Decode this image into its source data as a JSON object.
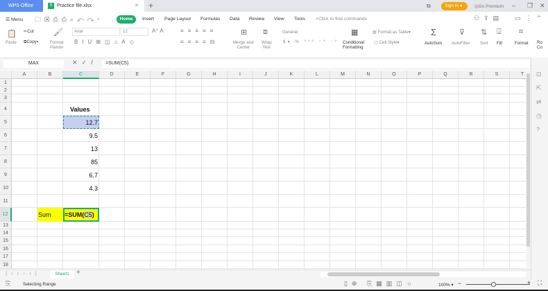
{
  "titlebar": {
    "app_tab": "WPS Office",
    "file_tab": "Practice file.xlsx",
    "sign_in": "Sign in",
    "go_premium": "Go Premium"
  },
  "menu": {
    "menu": "Menu",
    "tabs": [
      "Home",
      "Insert",
      "Page Layout",
      "Formulas",
      "Data",
      "Review",
      "View",
      "Tools"
    ],
    "search": "Click to find commands"
  },
  "ribbon": {
    "paste": "Paste",
    "cut": "Cut",
    "copy": "Copy",
    "format_painter_1": "Format",
    "format_painter_2": "Painter",
    "font": "Arial",
    "size": "12",
    "merge_1": "Merge and",
    "merge_2": "Center",
    "wrap_1": "Wrap",
    "wrap_2": "Text",
    "number_format": "General",
    "cond_1": "Conditional",
    "cond_2": "Formatting",
    "format_table": "Format as Table",
    "cell_style": "Cell Style",
    "autosum": "AutoSum",
    "autofilter": "AutoFilter",
    "sort": "Sort",
    "fill": "Fill",
    "format": "Format",
    "rows_cols_1": "Ro",
    "rows_cols_2": "Co"
  },
  "formula_bar": {
    "name_box": "MAX",
    "formula": "=SUM(C5)"
  },
  "grid": {
    "columns": [
      "A",
      "B",
      "C",
      "D",
      "E",
      "F",
      "G",
      "H",
      "I",
      "J",
      "K",
      "L",
      "M",
      "N",
      "O",
      "P",
      "Q",
      "R",
      "S",
      "T"
    ],
    "rows": [
      "1",
      "2",
      "3",
      "4",
      "5",
      "6",
      "7",
      "8",
      "9",
      "10",
      "11",
      "12",
      "13",
      "14",
      "15",
      "16",
      "17",
      "18"
    ],
    "header_c4": "Values",
    "values": [
      "12.7",
      "9.5",
      "13",
      "85",
      "6.7",
      "4.3"
    ],
    "label_b12": "Sum",
    "formula_c12_prefix": "=SUM(",
    "formula_c12_ref": "C5",
    "formula_c12_suffix": ")"
  },
  "sheets": {
    "tabs": [
      "Sheet1"
    ]
  },
  "status": {
    "mode": "Selecting Range",
    "zoom": "100%"
  },
  "colors": {
    "accent": "#1aae6c",
    "highlight": "#ffff00",
    "selection": "#c5cff0"
  }
}
